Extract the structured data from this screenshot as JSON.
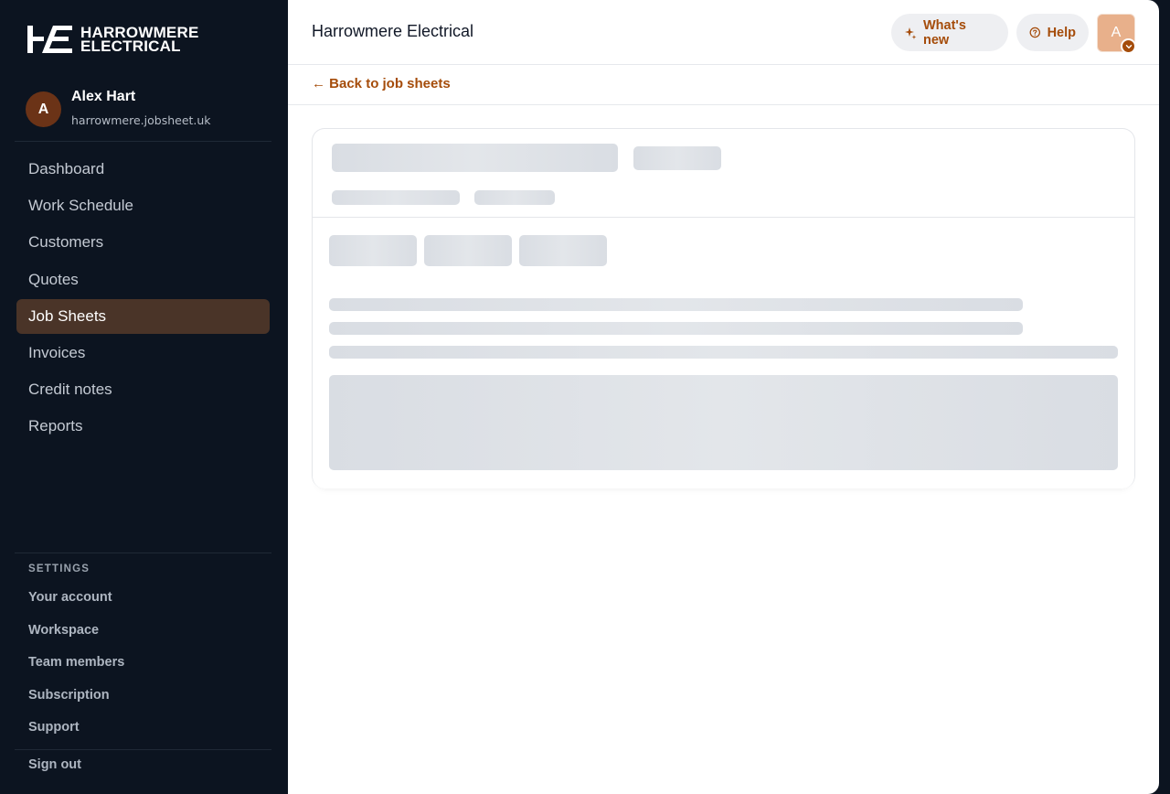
{
  "brand": {
    "line1": "HARROWMERE",
    "line2": "ELECTRICAL",
    "logo_icon": "he-monogram-logo"
  },
  "user": {
    "initial": "A",
    "name": "Alex Hart",
    "domain": "harrowmere.jobsheet.uk"
  },
  "nav": {
    "items": [
      {
        "label": "Dashboard",
        "active": false
      },
      {
        "label": "Work Schedule",
        "active": false
      },
      {
        "label": "Customers",
        "active": false
      },
      {
        "label": "Quotes",
        "active": false
      },
      {
        "label": "Job Sheets",
        "active": true
      },
      {
        "label": "Invoices",
        "active": false
      },
      {
        "label": "Credit notes",
        "active": false
      },
      {
        "label": "Reports",
        "active": false
      }
    ]
  },
  "settings": {
    "heading": "SETTINGS",
    "items": [
      {
        "label": "Your account"
      },
      {
        "label": "Workspace"
      },
      {
        "label": "Team members"
      },
      {
        "label": "Subscription"
      },
      {
        "label": "Support"
      }
    ],
    "sign_out": "Sign out"
  },
  "header": {
    "title": "Harrowmere Electrical",
    "whats_new_label": "What's new",
    "help_label": "Help",
    "avatar_initial": "A"
  },
  "back_link": "← Back to job sheets",
  "colors": {
    "accent": "#a54c0a",
    "sidebar_bg": "#0c1420",
    "nav_active_bg": "#4a3428",
    "skeleton": "#d9dde3"
  }
}
